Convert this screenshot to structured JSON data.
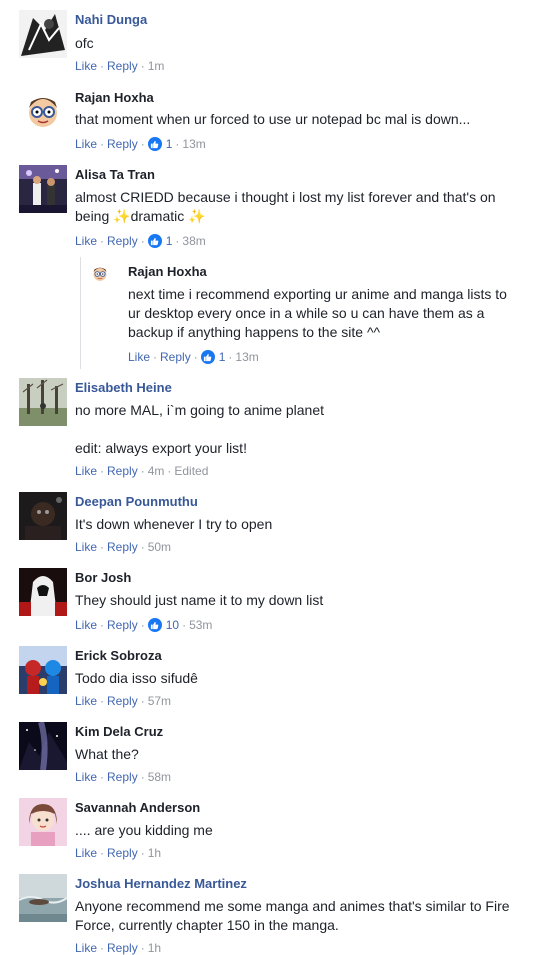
{
  "comments": [
    {
      "name": "Nahi Dunga",
      "lines": [
        "ofc"
      ],
      "actions": {
        "like": "Like",
        "reply": "Reply",
        "time": "1m"
      },
      "avatar": "manga-avatar"
    },
    {
      "name": "Rajan Hoxha",
      "lines": [
        "that moment when ur forced to use ur notepad bc mal is down..."
      ],
      "actions": {
        "like": "Like",
        "reply": "Reply",
        "reactions": "1",
        "time": "13m"
      },
      "avatar": "cartoon-avatar"
    },
    {
      "name": "Alisa Ta Tran",
      "lines": [
        "almost CRIEDD because i thought i lost my list forever and that's on",
        "being ✨dramatic ✨"
      ],
      "actions": {
        "like": "Like",
        "reply": "Reply",
        "reactions": "1",
        "time": "38m"
      },
      "avatar": "party-avatar"
    },
    {
      "name": "Rajan Hoxha",
      "lines": [
        "next time i recommend exporting ur anime and manga lists to",
        "ur desktop every once in a while so u can have them as a",
        "backup if anything happens to the site ^^"
      ],
      "actions": {
        "like": "Like",
        "reply": "Reply",
        "reactions": "1",
        "time": "13m"
      },
      "avatar": "cartoon-avatar"
    },
    {
      "name": "Elisabeth Heine",
      "lines": [
        "no more MAL, i`m going to anime planet",
        "",
        "edit: always export your list!"
      ],
      "actions": {
        "like": "Like",
        "reply": "Reply",
        "time": "4m",
        "edited": "Edited"
      },
      "avatar": "forest-avatar"
    },
    {
      "name": "Deepan Pounmuthu",
      "lines": [
        "It's down whenever I try to open"
      ],
      "actions": {
        "like": "Like",
        "reply": "Reply",
        "time": "50m"
      },
      "avatar": "dark-avatar"
    },
    {
      "name": "Bor Josh",
      "lines": [
        "They should just name it to my down list"
      ],
      "actions": {
        "like": "Like",
        "reply": "Reply",
        "reactions": "10",
        "time": "53m"
      },
      "avatar": "hooded-avatar"
    },
    {
      "name": "Erick Sobroza",
      "lines": [
        "Todo dia isso sifudê"
      ],
      "actions": {
        "like": "Like",
        "reply": "Reply",
        "time": "57m"
      },
      "avatar": "hero-avatar"
    },
    {
      "name": "Kim Dela Cruz",
      "lines": [
        "What the?"
      ],
      "actions": {
        "like": "Like",
        "reply": "Reply",
        "time": "58m"
      },
      "avatar": "galaxy-avatar"
    },
    {
      "name": "Savannah Anderson",
      "lines": [
        ".... are you kidding me"
      ],
      "actions": {
        "like": "Like",
        "reply": "Reply",
        "time": "1h"
      },
      "avatar": "girl-avatar"
    },
    {
      "name": "Joshua Hernandez Martinez",
      "lines": [
        "Anyone recommend me some manga and animes that's similar to Fire",
        "Force, currently chapter 150 in the manga."
      ],
      "actions": {
        "like": "Like",
        "reply": "Reply",
        "time": "1h"
      },
      "avatar": "beach-avatar"
    }
  ]
}
